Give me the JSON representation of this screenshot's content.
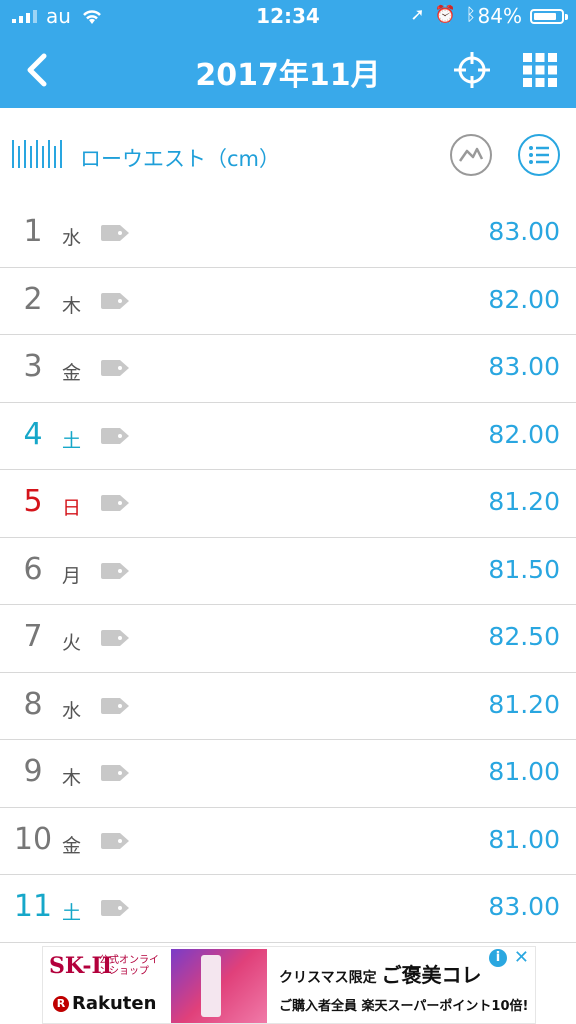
{
  "status": {
    "carrier": "au",
    "time": "12:34",
    "battery": "84%"
  },
  "nav": {
    "title": "2017年11月"
  },
  "section": {
    "title": "ローウエスト（cm）"
  },
  "rows": [
    {
      "day": "1",
      "weekday": "水",
      "value": "83.00",
      "kind": "weekday"
    },
    {
      "day": "2",
      "weekday": "木",
      "value": "82.00",
      "kind": "weekday"
    },
    {
      "day": "3",
      "weekday": "金",
      "value": "83.00",
      "kind": "weekday"
    },
    {
      "day": "4",
      "weekday": "土",
      "value": "82.00",
      "kind": "sat"
    },
    {
      "day": "5",
      "weekday": "日",
      "value": "81.20",
      "kind": "sun"
    },
    {
      "day": "6",
      "weekday": "月",
      "value": "81.50",
      "kind": "weekday"
    },
    {
      "day": "7",
      "weekday": "火",
      "value": "82.50",
      "kind": "weekday"
    },
    {
      "day": "8",
      "weekday": "水",
      "value": "81.20",
      "kind": "weekday"
    },
    {
      "day": "9",
      "weekday": "木",
      "value": "81.00",
      "kind": "weekday"
    },
    {
      "day": "10",
      "weekday": "金",
      "value": "81.00",
      "kind": "weekday"
    },
    {
      "day": "11",
      "weekday": "土",
      "value": "83.00",
      "kind": "sat"
    }
  ],
  "ad": {
    "brand": "SK-II",
    "brand_sub": "公式オンラインショップ",
    "rakuten": "Rakuten",
    "line1_small": "クリスマス限定",
    "line1_big": "ご褒美コレ",
    "line2": "ご購入者全員 楽天スーパーポイント10倍!"
  },
  "colors": {
    "header_blue": "#39a9ea",
    "value_blue": "#29a6e0",
    "saturday": "#16a7c9",
    "sunday": "#d4141b"
  },
  "icons": {
    "back": "chevron-left-icon",
    "target": "crosshair-icon",
    "grid": "grid-icon",
    "chart": "line-chart-icon",
    "list": "list-icon",
    "tag": "tag-icon",
    "section": "barcode-ruler-icon"
  }
}
